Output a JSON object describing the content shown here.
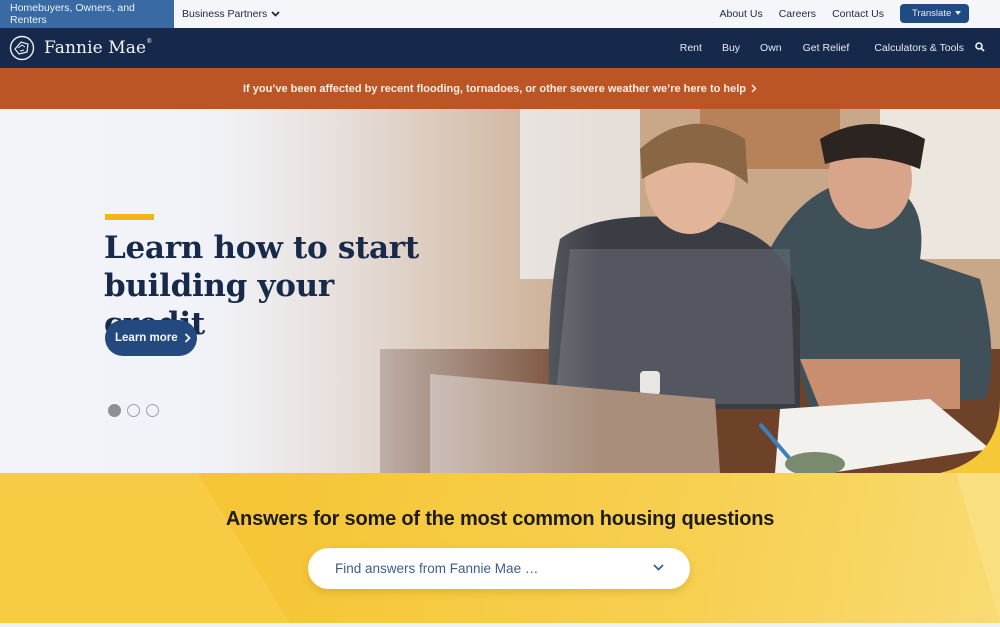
{
  "utility_bar": {
    "audience_tabs": [
      {
        "label": "Homebuyers, Owners, and Renters",
        "active": true
      },
      {
        "label": "Business Partners",
        "active": false,
        "has_dropdown": true
      }
    ],
    "links": [
      "About Us",
      "Careers",
      "Contact Us"
    ],
    "translate_label": "Translate"
  },
  "main_nav": {
    "brand": "Fannie Mae",
    "brand_mark": "®",
    "items": [
      "Rent",
      "Buy",
      "Own",
      "Get Relief",
      "Calculators & Tools"
    ],
    "search_icon": "search-icon"
  },
  "alert": {
    "text": "If you’ve been affected by recent flooding, tornadoes, or other severe weather we’re here to help"
  },
  "hero": {
    "title": "Learn how to start building your credit",
    "cta_label": "Learn more",
    "carousel": {
      "total": 3,
      "active_index": 0
    }
  },
  "answers": {
    "title": "Answers for some of the most common housing questions",
    "select_placeholder": "Find answers from Fannie Mae …"
  },
  "colors": {
    "navy": "#16294a",
    "active_tab": "#3a6aa4",
    "alert": "#bc5525",
    "accent_yellow": "#f2b416",
    "button_blue": "#23497f",
    "answers_bg": "#f6c737"
  }
}
